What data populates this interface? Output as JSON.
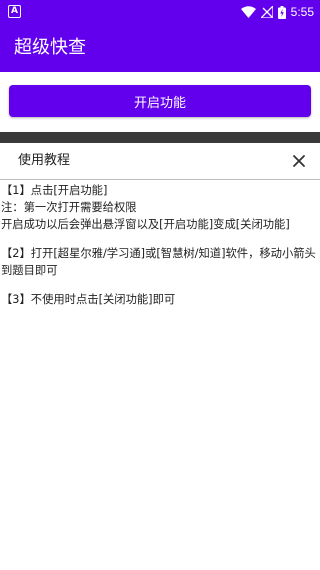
{
  "status_bar": {
    "left_icon_letter": "A",
    "time": "5:55",
    "icons": [
      "wifi-icon",
      "signal-icon",
      "battery-charging-icon"
    ]
  },
  "app_bar": {
    "title": "超级快查"
  },
  "main": {
    "start_button_label": "开启功能"
  },
  "dialog": {
    "title": "使用教程",
    "close_icon": "close-icon",
    "lines": {
      "s1_title": "【1】点击[开启功能]",
      "s1_note": "注：第一次打开需要给权限",
      "s1_detail": "开启成功以后会弹出悬浮窗以及[开启功能]变成[关闭功能]",
      "s2": "【2】打开[超星尔雅/学习通]或[智慧树/知道]软件，移动小箭头到题目即可",
      "s3": "【3】不使用时点击[关闭功能]即可"
    }
  },
  "colors": {
    "primary": "#6200ee",
    "overlay_bar": "#3a3a3a",
    "text": "#222222"
  }
}
